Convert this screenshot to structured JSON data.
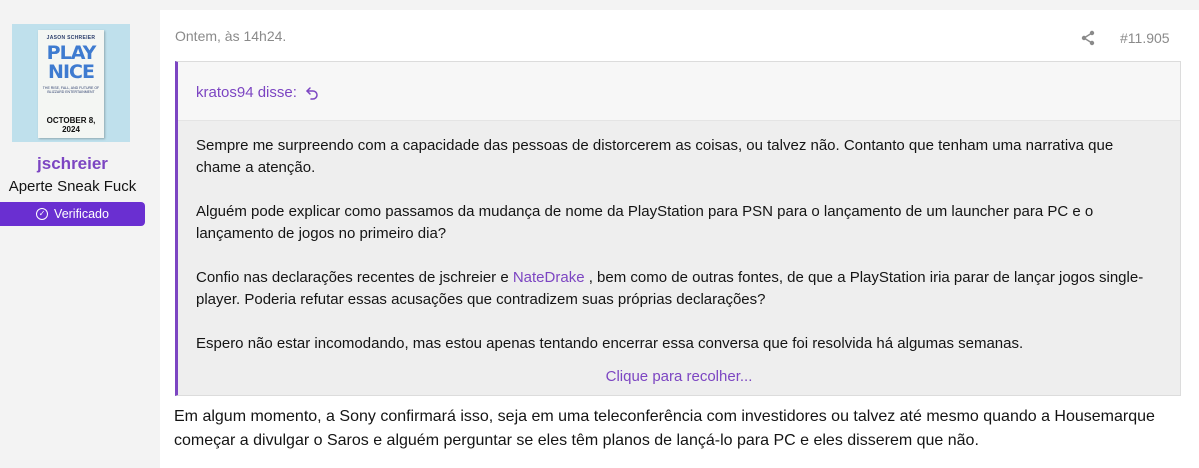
{
  "user": {
    "avatar": {
      "author": "JASON SCHREIER",
      "title_line1": "PLAY",
      "title_line2": "NICE",
      "subtitle": "THE RISE, FALL, AND FUTURE OF BLIZZARD ENTERTAINMENT",
      "date": "OCTOBER 8, 2024"
    },
    "name": "jschreier",
    "title": "Aperte Sneak Fuck",
    "badge_label": "Verificado"
  },
  "post": {
    "date": "Ontem, às 14h24.",
    "number": "#11.905",
    "quote": {
      "author_label": "kratos94 disse:",
      "paragraphs": {
        "p1": "Sempre me surpreendo com a capacidade das pessoas de distorcerem as coisas, ou talvez não. Contanto que tenham uma narrativa que chame a atenção.",
        "p2": "Alguém pode explicar como passamos da mudança de nome da PlayStation para PSN para o lançamento de um launcher para PC e o lançamento de jogos no primeiro dia?",
        "p3_before": "Confio nas declarações recentes de jschreier e ",
        "p3_mention": "NateDrake",
        "p3_after": " , bem como de outras fontes, de que a PlayStation iria parar de lançar jogos single-player. Poderia refutar essas acusações que contradizem suas próprias declarações?",
        "p4": "Espero não estar incomodando, mas estou apenas tentando encerrar essa conversa que foi resolvida há algumas semanas."
      },
      "collapse_label": "Clique para recolher..."
    },
    "body": "Em algum momento, a Sony confirmará isso, seja em uma teleconferência com investidores ou talvez até mesmo quando a Housemarque começar a divulgar o Saros e alguém perguntar se eles têm planos de lançá-lo para PC e eles disserem que não."
  },
  "colors": {
    "accent": "#7c45c2",
    "badge": "#6a2fd1",
    "muted": "#8a8a8a"
  },
  "icons": [
    "check-circle-icon",
    "share-icon",
    "reply-arrow-icon"
  ]
}
